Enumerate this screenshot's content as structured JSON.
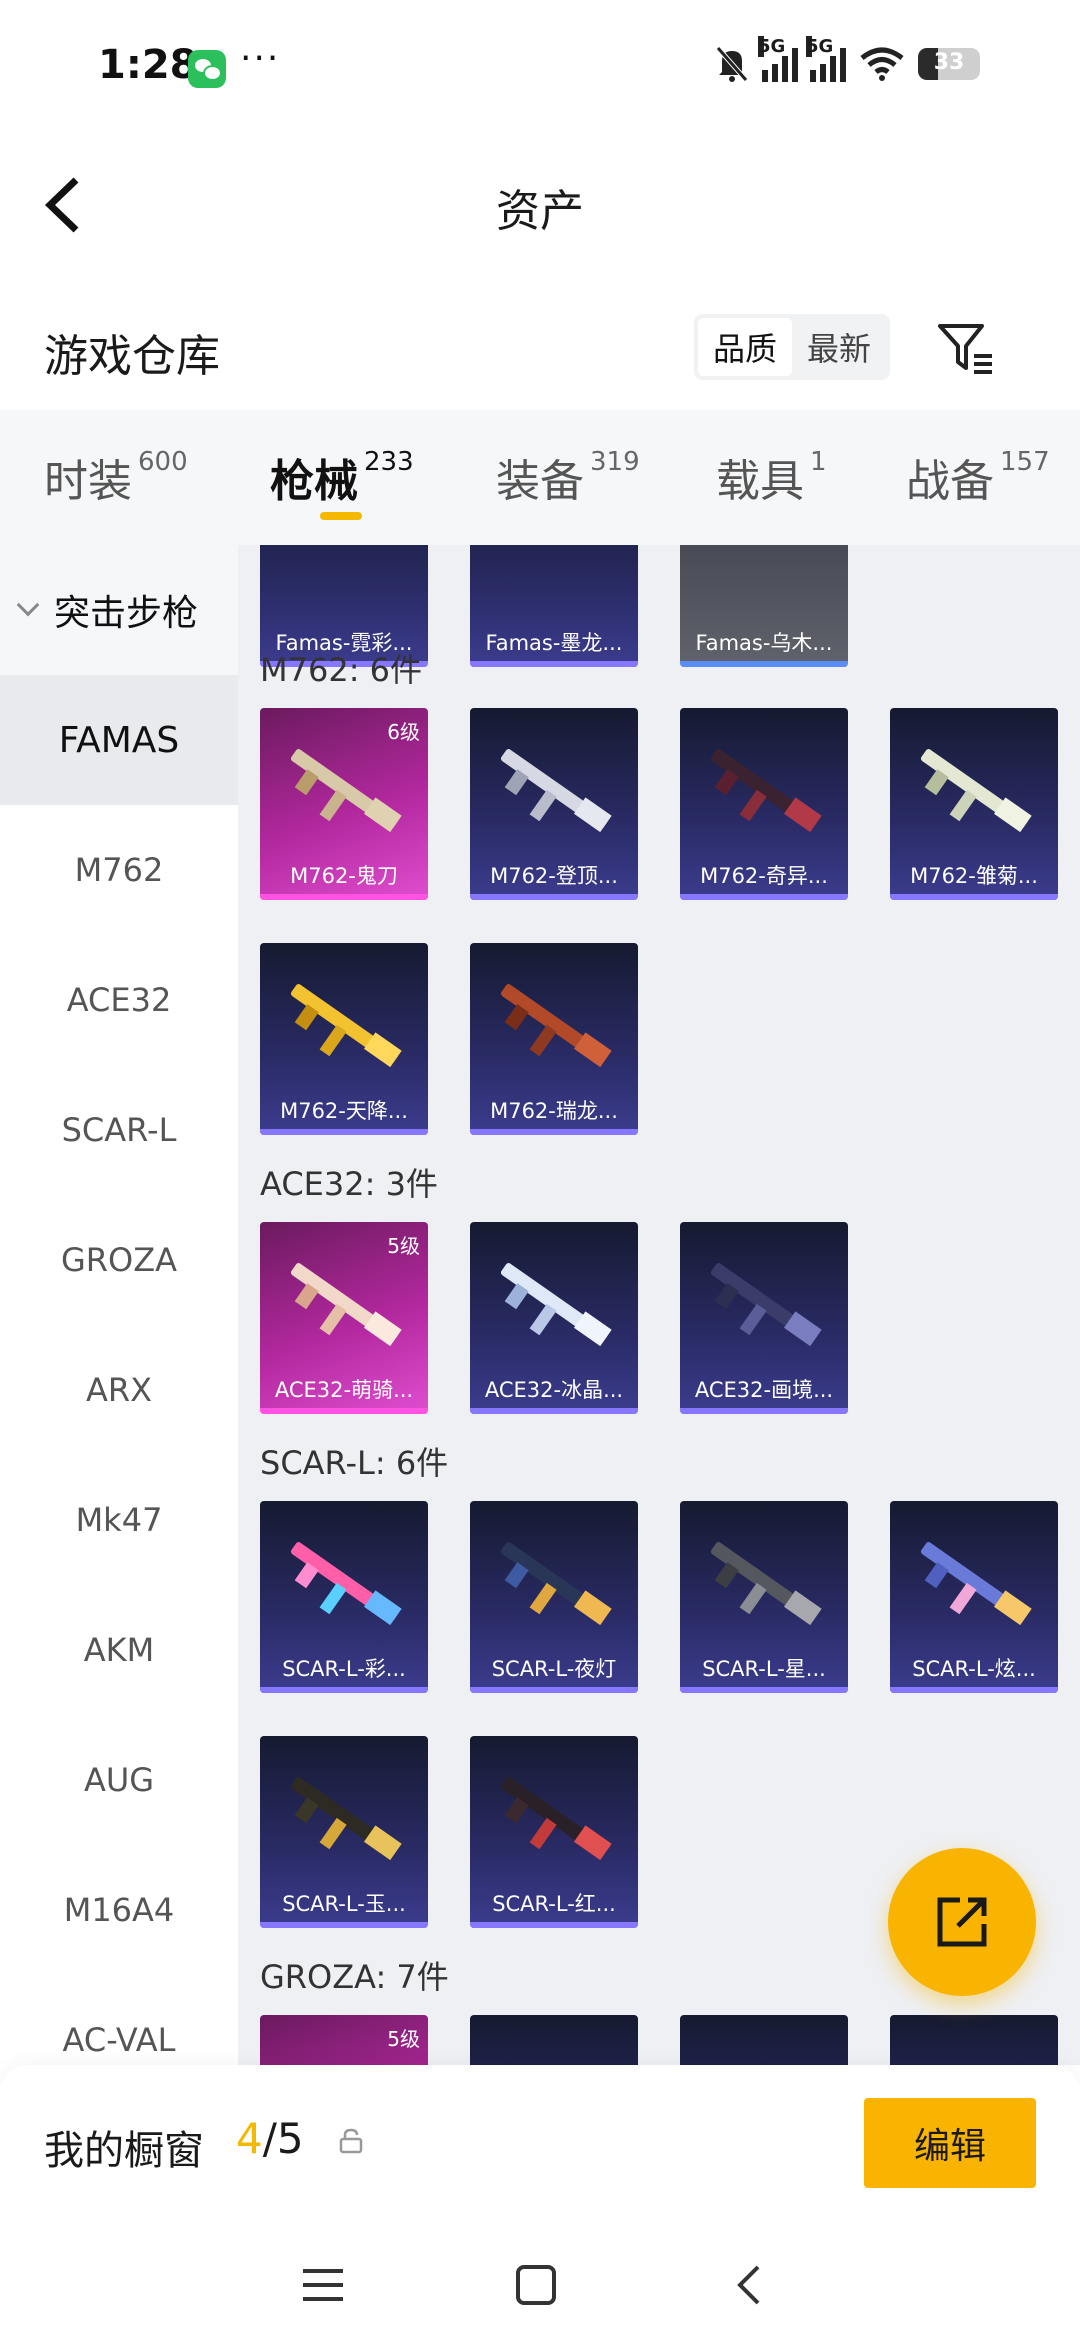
{
  "status_bar": {
    "time": "1:28",
    "more": "···",
    "battery": "33",
    "net1": "5G",
    "net2": "5G"
  },
  "header": {
    "title": "资产"
  },
  "warehouse": {
    "title": "游戏仓库",
    "sort_options": [
      "品质",
      "最新"
    ]
  },
  "tabs": [
    {
      "label": "时装",
      "count": "600"
    },
    {
      "label": "枪械",
      "count": "233"
    },
    {
      "label": "装备",
      "count": "319"
    },
    {
      "label": "载具",
      "count": "1"
    },
    {
      "label": "战备",
      "count": "157"
    }
  ],
  "sidebar": {
    "category": "突击步枪",
    "items": [
      "FAMAS",
      "M762",
      "ACE32",
      "SCAR-L",
      "GROZA",
      "ARX",
      "Mk47",
      "AKM",
      "AUG",
      "M16A4",
      "AC-VAL"
    ]
  },
  "sections": {
    "famas": {
      "items": [
        "Famas-霓彩...",
        "Famas-墨龙...",
        "Famas-乌木..."
      ]
    },
    "m762": {
      "title": "M762: 6件",
      "items": [
        "M762-鬼刀",
        "M762-登顶...",
        "M762-奇异...",
        "M762-雏菊...",
        "M762-天降...",
        "M762-瑞龙..."
      ],
      "level": "6级"
    },
    "ace32": {
      "title": "ACE32: 3件",
      "items": [
        "ACE32-萌骑...",
        "ACE32-冰晶...",
        "ACE32-画境..."
      ],
      "level": "5级"
    },
    "scarl": {
      "title": "SCAR-L: 6件",
      "items": [
        "SCAR-L-彩...",
        "SCAR-L-夜灯",
        "SCAR-L-星...",
        "SCAR-L-炫...",
        "SCAR-L-玉...",
        "SCAR-L-红..."
      ]
    },
    "groza": {
      "title": "GROZA: 7件",
      "level": "5级"
    }
  },
  "bottom": {
    "label": "我的橱窗",
    "current": "4",
    "total": "/5",
    "edit": "编辑"
  },
  "colors": {
    "accent": "#f8b400",
    "card_rare": "#e04ed0",
    "card_normal": "#2a2b66"
  }
}
